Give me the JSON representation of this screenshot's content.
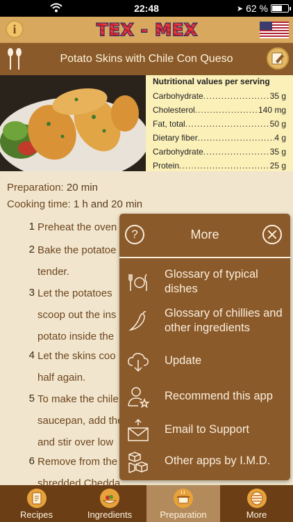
{
  "status": {
    "time": "22:48",
    "battery_percent": "62 %",
    "battery_level": 0.62
  },
  "header": {
    "logo_text": "TEX - MEX",
    "flag": "us-flag-icon"
  },
  "recipe": {
    "title": "Potato Skins with Chile Con Queso",
    "preparation_label": "Preparation:",
    "preparation_value": "20 min",
    "cooking_label": "Cooking time:",
    "cooking_value": "1 h and 20 min",
    "steps": [
      {
        "num": "1",
        "text": "Preheat the oven"
      },
      {
        "num": "2",
        "text": "Bake the potatoe tender."
      },
      {
        "num": "3",
        "text": "Let the potatoes scoop out the ins potato inside the"
      },
      {
        "num": "4",
        "text": "Let the skins coo half again."
      },
      {
        "num": "5",
        "text": "To make the chile saucepan, add the and stir over low"
      },
      {
        "num": "6",
        "text": "Remove from the shredded Chedda"
      }
    ]
  },
  "nutrition": {
    "heading": "Nutritional values per serving",
    "rows": [
      {
        "label": "Carbohydrate",
        "value": "35 g"
      },
      {
        "label": "Cholesterol",
        "value": "140 mg"
      },
      {
        "label": "Fat, total",
        "value": "50 g"
      },
      {
        "label": "Dietary fiber",
        "value": "4 g"
      },
      {
        "label": "Carbohydrate",
        "value": "35 g"
      },
      {
        "label": "Protein",
        "value": "25 g"
      }
    ]
  },
  "popup": {
    "title": "More",
    "items": [
      {
        "label": "Glossary of typical dishes",
        "icon": "cutlery-icon"
      },
      {
        "label": "Glossary of chillies and other ingredients",
        "icon": "chili-icon"
      },
      {
        "label": "Update",
        "icon": "cloud-download-icon"
      },
      {
        "label": "Recommend this app",
        "icon": "person-star-icon"
      },
      {
        "label": "Email to Support",
        "icon": "envelope-icon"
      },
      {
        "label": "Other apps by I.M.D.",
        "icon": "boxes-icon"
      }
    ]
  },
  "tabs": [
    {
      "label": "Recipes",
      "icon": "recipe-book-icon",
      "active": false
    },
    {
      "label": "Ingredients",
      "icon": "ingredients-icon",
      "active": false
    },
    {
      "label": "Preparation",
      "icon": "cooking-pot-icon",
      "active": true
    },
    {
      "label": "More",
      "icon": "more-icon",
      "active": false
    }
  ],
  "colors": {
    "header": "#d9a85f",
    "titlebar": "#8a5a2b",
    "popup": "#8a5a2b",
    "tabbar": "#6b3e16",
    "tab_active": "#b38a5c",
    "background": "#f1e6cd"
  }
}
